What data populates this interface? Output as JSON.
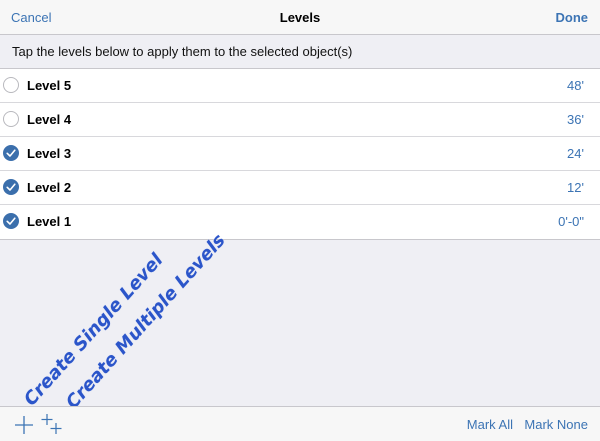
{
  "navbar": {
    "cancel_label": "Cancel",
    "title": "Levels",
    "done_label": "Done"
  },
  "instructions": "Tap the levels below to apply them to the selected object(s)",
  "levels": [
    {
      "name": "Level 5",
      "elevation": "48'",
      "selected": false
    },
    {
      "name": "Level 4",
      "elevation": "36'",
      "selected": false
    },
    {
      "name": "Level 3",
      "elevation": "24'",
      "selected": true
    },
    {
      "name": "Level 2",
      "elevation": "12'",
      "selected": true
    },
    {
      "name": "Level 1",
      "elevation": "0'-0\"",
      "selected": true
    }
  ],
  "annotations": {
    "single": "Create Single Level",
    "multiple": "Create Multiple Levels"
  },
  "toolbar": {
    "add_icon": "plus-icon",
    "add_multiple_icon": "plus-multiple-icon",
    "mark_all_label": "Mark All",
    "mark_none_label": "Mark None"
  },
  "colors": {
    "accent": "#3c74b4",
    "check_fill": "#3b6fac",
    "annotation": "#2b55c9",
    "background": "#efeff4"
  }
}
